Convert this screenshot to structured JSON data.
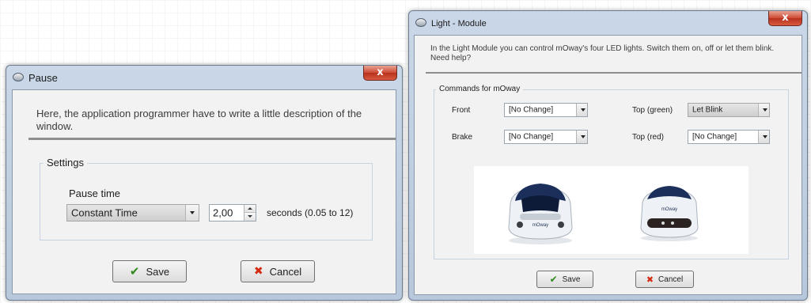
{
  "pause_dialog": {
    "title": "Pause",
    "close_label": "x",
    "description": "Here, the application programmer have to write a little description of the window.",
    "settings": {
      "group_label": "Settings",
      "pause_time_label": "Pause time",
      "mode_value": "Constant Time",
      "spinner_value": "2,00",
      "units_text": "seconds (0.05 to 12)"
    },
    "buttons": {
      "save": "Save",
      "cancel": "Cancel"
    }
  },
  "light_dialog": {
    "title": "Light - Module",
    "close_label": "x",
    "description": "In the Light Module you can control mOway's four LED lights. Switch them on, off or let them blink. Need help?",
    "commands": {
      "group_label": "Commands for mOway",
      "front_label": "Front",
      "front_value": "[No Change]",
      "top_green_label": "Top (green)",
      "top_green_value": "Let Blink",
      "brake_label": "Brake",
      "brake_value": "[No Change]",
      "top_red_label": "Top (red)",
      "top_red_value": "[No Change]"
    },
    "robot_brand": "mOway",
    "buttons": {
      "save": "Save",
      "cancel": "Cancel"
    }
  },
  "icons": {
    "title_icon": "moway-logo-icon",
    "save": "check-icon",
    "cancel": "x-icon"
  },
  "colors": {
    "title_bar": "#c3d3e6",
    "close_button": "#c9462f",
    "save_check": "#2f8a1d",
    "cancel_x": "#d42a12"
  }
}
